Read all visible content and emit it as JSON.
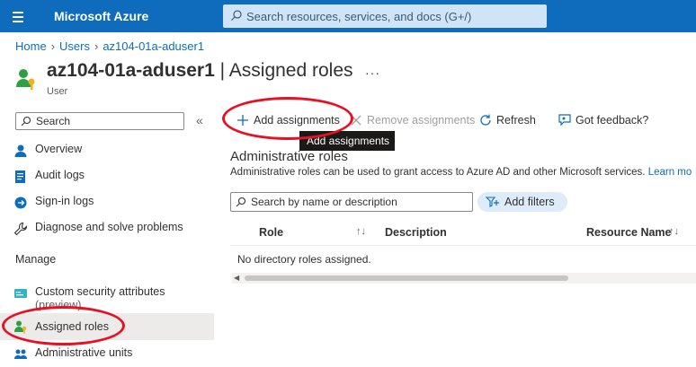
{
  "topbar": {
    "brand": "Microsoft Azure",
    "search_placeholder": "Search resources, services, and docs (G+/)",
    "color": "#0f6cbd"
  },
  "breadcrumb": [
    "Home",
    "Users",
    "az104-01a-aduser1"
  ],
  "header": {
    "name": "az104-01a-aduser1",
    "separator": " | ",
    "page": "Assigned roles",
    "subtitle": "User",
    "more": "···"
  },
  "sidebar": {
    "search_placeholder": "Search",
    "collapse": "«",
    "items": [
      {
        "label": "Overview",
        "icon": "user-icon"
      },
      {
        "label": "Audit logs",
        "icon": "audit-logs-icon"
      },
      {
        "label": "Sign-in logs",
        "icon": "sign-in-icon"
      },
      {
        "label": "Diagnose and solve problems",
        "icon": "wrench-icon"
      }
    ],
    "manage_heading": "Manage",
    "manage_items": [
      {
        "label": "Custom security attributes",
        "label2": "(preview)",
        "icon": "attributes-icon"
      },
      {
        "label": "Assigned roles",
        "icon": "assigned-roles-icon",
        "active": true
      },
      {
        "label": "Administrative units",
        "icon": "admin-units-icon"
      }
    ]
  },
  "toolbar": {
    "add": "Add assignments",
    "remove": "Remove assignments",
    "refresh": "Refresh",
    "feedback": "Got feedback?",
    "tooltip": "Add assignments"
  },
  "content": {
    "heading": "Administrative roles",
    "description": "Administrative roles can be used to grant access to Azure AD and other Microsoft services.",
    "learn_more": "Learn mo",
    "search_placeholder": "Search by name or description",
    "filters": "Add filters",
    "columns": [
      "Role",
      "Description",
      "Resource Name"
    ],
    "sort_glyph": "↑↓",
    "empty_message": "No directory roles assigned."
  },
  "colors": {
    "accent": "#0f6cbd",
    "highlight_ring": "#e81123"
  }
}
